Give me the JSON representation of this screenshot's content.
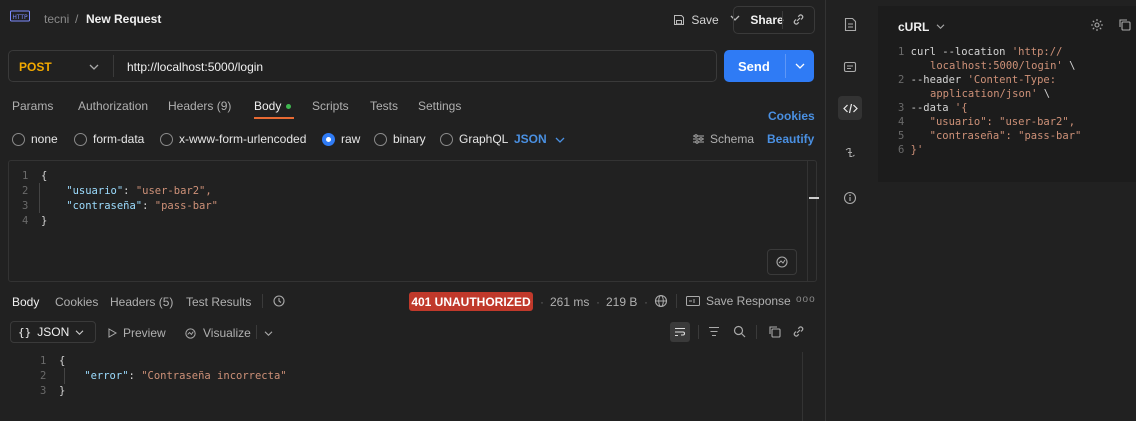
{
  "header": {
    "workspace": "tecni",
    "separator": "/",
    "request_name": "New Request",
    "save_label": "Save",
    "share_label": "Share"
  },
  "request": {
    "method": "POST",
    "url": "http://localhost:5000/login",
    "send_label": "Send"
  },
  "tabs": {
    "params": "Params",
    "authorization": "Authorization",
    "headers": "Headers (9)",
    "body": "Body",
    "scripts": "Scripts",
    "tests": "Tests",
    "settings": "Settings",
    "cookies": "Cookies"
  },
  "body_types": {
    "none": "none",
    "form_data": "form-data",
    "urlencoded": "x-www-form-urlencoded",
    "raw": "raw",
    "binary": "binary",
    "graphql": "GraphQL",
    "format": "JSON",
    "schema": "Schema",
    "beautify": "Beautify"
  },
  "editor": {
    "lines": [
      {
        "n": "1",
        "t": "{"
      },
      {
        "n": "2",
        "k": "\"usuario\"",
        "v": "\"user-bar2\","
      },
      {
        "n": "3",
        "k": "\"contraseña\"",
        "v": "\"pass-bar\""
      },
      {
        "n": "4",
        "t": "}"
      }
    ]
  },
  "response": {
    "tab_body": "Body",
    "tab_cookies": "Cookies",
    "tab_headers": "Headers (5)",
    "tab_tests": "Test Results",
    "status": "401 UNAUTHORIZED",
    "time": "261 ms",
    "size": "219 B",
    "save_response": "Save Response",
    "format": "JSON",
    "preview": "Preview",
    "visualize": "Visualize",
    "lines": [
      {
        "n": "1",
        "t": "{"
      },
      {
        "n": "2",
        "k": "\"error\"",
        "v": "\"Contraseña incorrecta\""
      },
      {
        "n": "3",
        "t": "}"
      }
    ]
  },
  "curl": {
    "title": "cURL",
    "lines": [
      {
        "n": "1",
        "a": "curl --location ",
        "b": "'http://"
      },
      {
        "n": "",
        "a": "",
        "b": "localhost:5000/login'",
        "c": " \\"
      },
      {
        "n": "2",
        "a": "--header ",
        "b": "'Content-Type:"
      },
      {
        "n": "",
        "a": "",
        "b": "application/json'",
        "c": " \\"
      },
      {
        "n": "3",
        "a": "--data ",
        "b": "'{"
      },
      {
        "n": "4",
        "a": "",
        "b": "\"usuario\": \"user-bar2\","
      },
      {
        "n": "5",
        "a": "",
        "b": "\"contraseña\": \"pass-bar\""
      },
      {
        "n": "6",
        "a": "",
        "b": "}'"
      }
    ]
  },
  "colors": {
    "accent": "#2f7bf5",
    "status_error": "#c0392b",
    "body_dot": "#3fb950",
    "tab_underline": "#e86a33"
  }
}
